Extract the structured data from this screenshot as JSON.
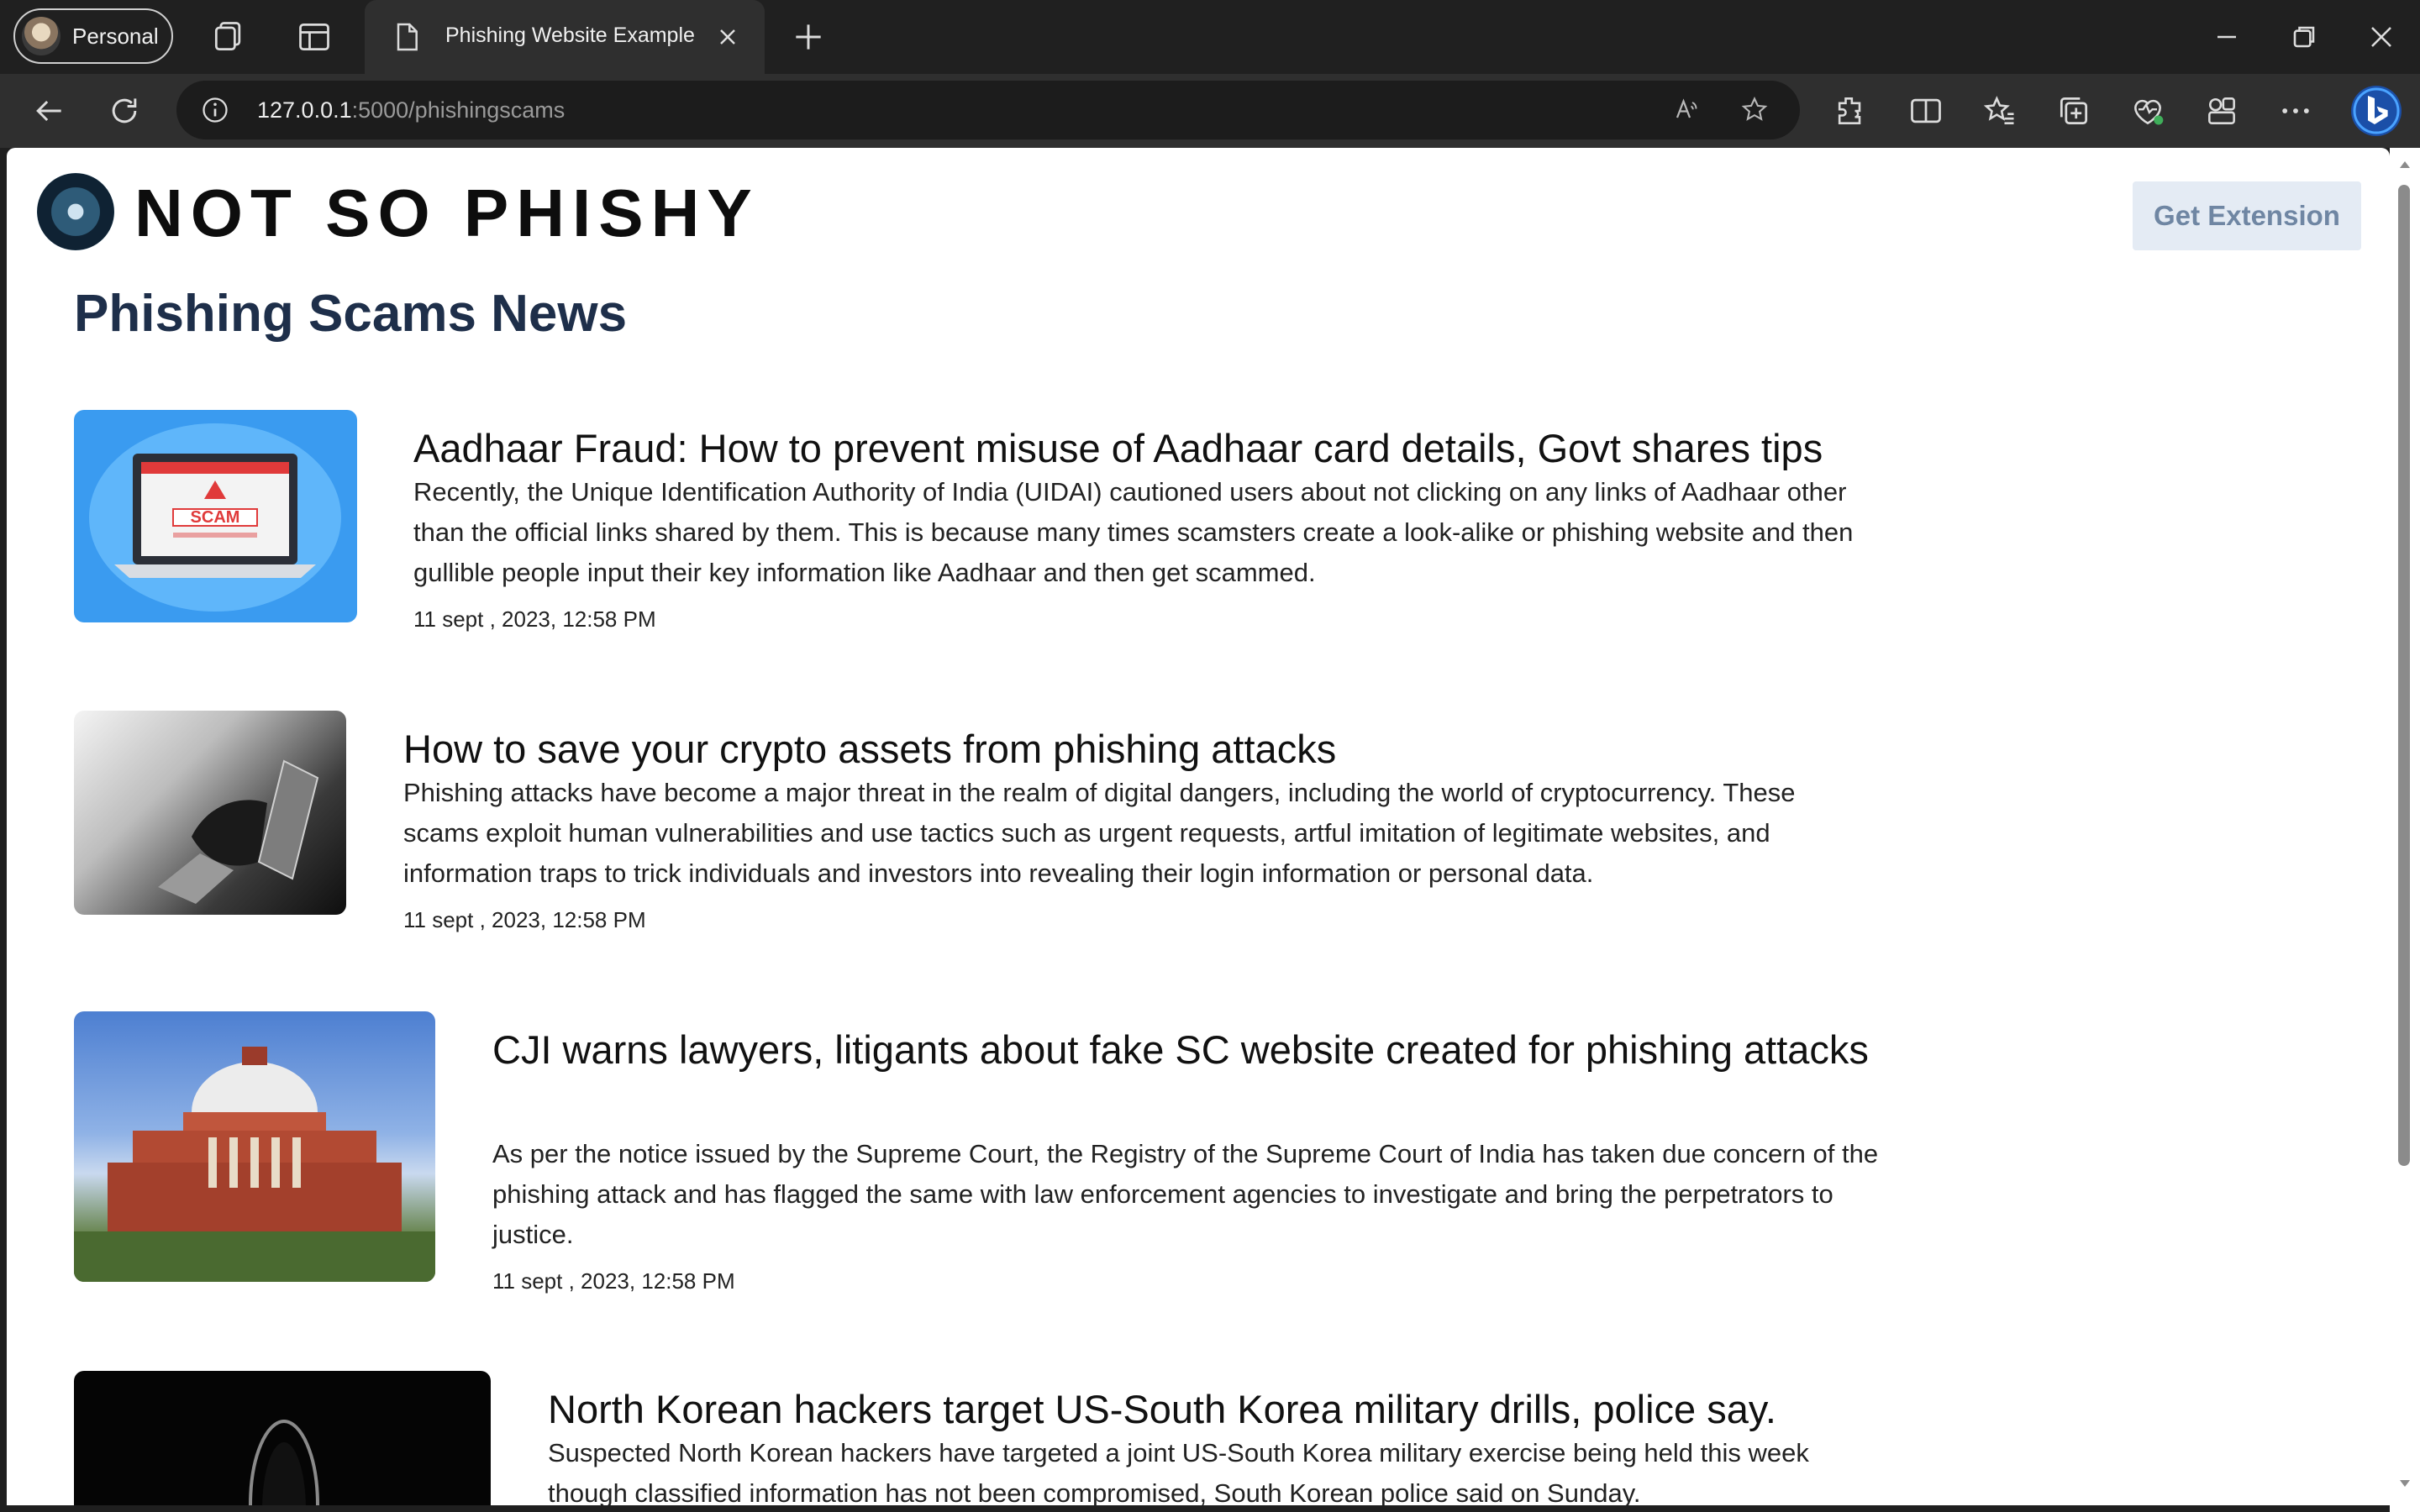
{
  "browser": {
    "profile_label": "Personal",
    "tab_title": "Phishing Website Example",
    "url_host": "127.0.0.1",
    "url_path": ":5000/phishingscams"
  },
  "header": {
    "site_name": "NOT SO PHISHY",
    "get_extension_label": "Get Extension"
  },
  "main": {
    "heading": "Phishing Scams News",
    "articles": [
      {
        "title": "Aadhaar Fraud: How to prevent misuse of Aadhaar card details, Govt shares tips",
        "body": "Recently, the Unique Identification Authority of India (UIDAI) cautioned users about not clicking on any links of Aadhaar other than the official links shared by them. This is because many times scamsters create a look-alike or phishing website and then gullible people input their key information like Aadhaar and then get scammed.",
        "date": "11 sept , 2023, 12:58 PM",
        "image_text": "SCAM"
      },
      {
        "title": "How to save your crypto assets from phishing attacks",
        "body": "Phishing attacks have become a major threat in the realm of digital dangers, including the world of cryptocurrency. These scams exploit human vulnerabilities and use tactics such as urgent requests, artful imitation of legitimate websites, and information traps to trick individuals and investors into revealing their login information or personal data.",
        "date": "11 sept , 2023, 12:58 PM"
      },
      {
        "title": "CJI warns lawyers, litigants about fake SC website created for phishing attacks",
        "body": "As per the notice issued by the Supreme Court, the Registry of the Supreme Court of India has taken due concern of the phishing attack and has flagged the same with law enforcement agencies to investigate and bring the perpetrators to justice.",
        "date": "11 sept , 2023, 12:58 PM"
      },
      {
        "title": "North Korean hackers target US-South Korea military drills, police say.",
        "body": "Suspected North Korean hackers have targeted a joint US-South Korea military exercise being held this week though classified information has not been compromised, South Korean police said on Sunday.",
        "date": ""
      }
    ]
  }
}
